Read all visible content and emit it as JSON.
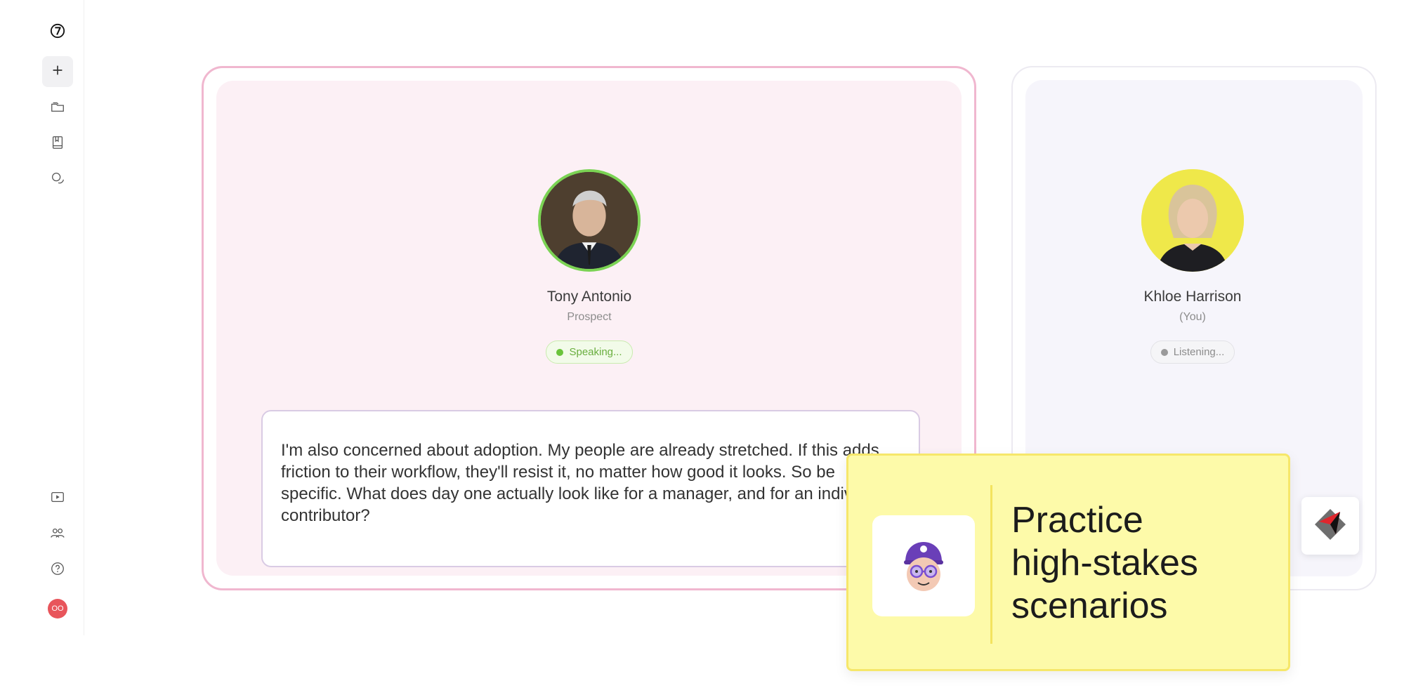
{
  "sidebar": {
    "items": [
      {
        "icon": "logo-icon"
      },
      {
        "icon": "plus-icon"
      },
      {
        "icon": "folder-icon"
      },
      {
        "icon": "book-icon"
      },
      {
        "icon": "chat-icon"
      },
      {
        "icon": "video-icon"
      },
      {
        "icon": "team-icon"
      },
      {
        "icon": "help-icon"
      }
    ],
    "user_initials": "OO",
    "user_color": "#e8555b"
  },
  "prospect": {
    "name": "Tony Antonio",
    "role": "Prospect",
    "status": "Speaking...",
    "accent": "#7bd354"
  },
  "you": {
    "name": "Khloe Harrison",
    "role": "(You)",
    "status": "Listening...",
    "accent": "#efe84a"
  },
  "transcript": {
    "text": "I'm also concerned about adoption. My people are already stretched. If this adds friction to their workflow, they'll resist it, no matter how good it looks. So be specific. What does day one actually look like for a manager, and for an individual contributor?"
  },
  "promo": {
    "line1": "Practice",
    "line2": "high-stakes",
    "line3": "scenarios"
  },
  "colors": {
    "prospect_border": "#f0b7cf",
    "prospect_bg": "#fcf0f5",
    "promo_bg": "#fdfaa9"
  }
}
